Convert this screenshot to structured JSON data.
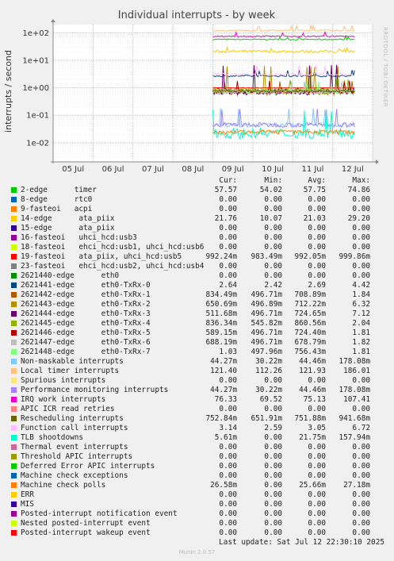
{
  "chart_data": {
    "type": "line",
    "title": "Individual interrupts - by week",
    "ylabel": "interrupts / second",
    "yscale": "log",
    "ylim": [
      0.002,
      200
    ],
    "y_ticks": [
      {
        "value": 100,
        "label": "1e+02"
      },
      {
        "value": 10,
        "label": "1e+01"
      },
      {
        "value": 1,
        "label": "1e+00"
      },
      {
        "value": 0.1,
        "label": "1e-01"
      },
      {
        "value": 0.01,
        "label": "1e-02"
      }
    ],
    "x_ticks": [
      "05 Jul",
      "06 Jul",
      "07 Jul",
      "08 Jul",
      "09 Jul",
      "10 Jul",
      "11 Jul",
      "12 Jul"
    ],
    "data_start_day": 4.0,
    "data_end_day": 7.55,
    "grid": true,
    "side_label": "RRDTOOL / TOBI OETIKER",
    "column_headers": [
      "Cur:",
      "Min:",
      "Avg:",
      "Max:"
    ],
    "series": [
      {
        "name": "2-edge      timer",
        "color": "#00cc00",
        "avg": 57.75,
        "min": 54.02,
        "max": 74.86,
        "cur": "57.57",
        "smin": "54.02",
        "savg": "57.75",
        "smax": "74.86"
      },
      {
        "name": "8-edge      rtc0",
        "color": "#0066b3",
        "avg": 0,
        "min": 0,
        "max": 0,
        "cur": "0.00",
        "smin": "0.00",
        "savg": "0.00",
        "smax": "0.00"
      },
      {
        "name": "9-fasteoi   acpi",
        "color": "#ff8000",
        "avg": 0,
        "min": 0,
        "max": 0,
        "cur": "0.00",
        "smin": "0.00",
        "savg": "0.00",
        "smax": "0.00"
      },
      {
        "name": "14-edge      ata_piix",
        "color": "#ffcc00",
        "avg": 21.03,
        "min": 10.07,
        "max": 29.2,
        "cur": "21.76",
        "smin": "10.07",
        "savg": "21.03",
        "smax": "29.20"
      },
      {
        "name": "15-edge      ata_piix",
        "color": "#330099",
        "avg": 0,
        "min": 0,
        "max": 0,
        "cur": "0.00",
        "smin": "0.00",
        "savg": "0.00",
        "smax": "0.00"
      },
      {
        "name": "16-fasteoi   uhci_hcd:usb3",
        "color": "#990099",
        "avg": 0,
        "min": 0,
        "max": 0,
        "cur": "0.00",
        "smin": "0.00",
        "savg": "0.00",
        "smax": "0.00"
      },
      {
        "name": "18-fasteoi   ehci_hcd:usb1, uhci_hcd:usb6",
        "color": "#ccff00",
        "avg": 0,
        "min": 0,
        "max": 0,
        "cur": "0.00",
        "smin": "0.00",
        "savg": "0.00",
        "smax": "0.00"
      },
      {
        "name": "19-fasteoi   ata_piix, uhci_hcd:usb5",
        "color": "#ff0000",
        "avg": 0.99205,
        "min": 0.98349,
        "max": 0.99986,
        "cur": "992.24m",
        "smin": "983.49m",
        "savg": "992.05m",
        "smax": "999.86m"
      },
      {
        "name": "23-fasteoi   ehci_hcd:usb2, uhci_hcd:usb4",
        "color": "#808080",
        "avg": 0,
        "min": 0,
        "max": 0,
        "cur": "0.00",
        "smin": "0.00",
        "savg": "0.00",
        "smax": "0.00"
      },
      {
        "name": "2621440-edge      eth0",
        "color": "#008f00",
        "avg": 0,
        "min": 0,
        "max": 0,
        "cur": "0.00",
        "smin": "0.00",
        "savg": "0.00",
        "smax": "0.00"
      },
      {
        "name": "2621441-edge      eth0-TxRx-0",
        "color": "#00487d",
        "avg": 2.69,
        "min": 2.42,
        "max": 4.42,
        "cur": "2.64",
        "smin": "2.42",
        "savg": "2.69",
        "smax": "4.42"
      },
      {
        "name": "2621442-edge      eth0-TxRx-1",
        "color": "#b35a00",
        "avg": 0.70889,
        "min": 0.49671,
        "max": 1.84,
        "cur": "834.49m",
        "smin": "496.71m",
        "savg": "708.89m",
        "smax": "1.84"
      },
      {
        "name": "2621443-edge      eth0-TxRx-2",
        "color": "#b38f00",
        "avg": 0.71222,
        "min": 0.49689,
        "max": 6.32,
        "cur": "650.69m",
        "smin": "496.89m",
        "savg": "712.22m",
        "smax": "6.32"
      },
      {
        "name": "2621444-edge      eth0-TxRx-3",
        "color": "#6b006b",
        "avg": 0.72465,
        "min": 0.49671,
        "max": 7.12,
        "cur": "511.68m",
        "smin": "496.71m",
        "savg": "724.65m",
        "smax": "7.12"
      },
      {
        "name": "2621445-edge      eth0-TxRx-4",
        "color": "#8fb300",
        "avg": 0.86056,
        "min": 0.54582,
        "max": 2.04,
        "cur": "836.34m",
        "smin": "545.82m",
        "savg": "860.56m",
        "smax": "2.04"
      },
      {
        "name": "2621446-edge      eth0-TxRx-5",
        "color": "#b30000",
        "avg": 0.7244,
        "min": 0.49671,
        "max": 1.81,
        "cur": "589.15m",
        "smin": "496.71m",
        "savg": "724.40m",
        "smax": "1.81"
      },
      {
        "name": "2621447-edge      eth0-TxRx-6",
        "color": "#bebebe",
        "avg": 0.67879,
        "min": 0.49671,
        "max": 1.82,
        "cur": "688.19m",
        "smin": "496.71m",
        "savg": "678.79m",
        "smax": "1.82"
      },
      {
        "name": "2621448-edge      eth0-TxRx-7",
        "color": "#80ff80",
        "avg": 0.75643,
        "min": 0.49796,
        "max": 1.81,
        "cur": "1.03",
        "smin": "497.96m",
        "savg": "756.43m",
        "smax": "1.81"
      },
      {
        "name": "Non-maskable interrupts",
        "color": "#80c9ff",
        "avg": 0.04446,
        "min": 0.03022,
        "max": 0.17808,
        "cur": "44.27m",
        "smin": "30.22m",
        "savg": "44.46m",
        "smax": "178.08m"
      },
      {
        "name": "Local timer interrupts",
        "color": "#ffc080",
        "avg": 121.93,
        "min": 112.26,
        "max": 186.01,
        "cur": "121.40",
        "smin": "112.26",
        "savg": "121.93",
        "smax": "186.01"
      },
      {
        "name": "Spurious interrupts",
        "color": "#ffe680",
        "avg": 0,
        "min": 0,
        "max": 0,
        "cur": "0.00",
        "smin": "0.00",
        "savg": "0.00",
        "smax": "0.00"
      },
      {
        "name": "Performance monitoring interrupts",
        "color": "#aa80ff",
        "avg": 0.04446,
        "min": 0.03022,
        "max": 0.17808,
        "cur": "44.27m",
        "smin": "30.22m",
        "savg": "44.46m",
        "smax": "178.08m"
      },
      {
        "name": "IRQ work interrupts",
        "color": "#ee00cc",
        "avg": 75.13,
        "min": 69.52,
        "max": 107.41,
        "cur": "76.33",
        "smin": "69.52",
        "savg": "75.13",
        "smax": "107.41"
      },
      {
        "name": "APIC ICR read retries",
        "color": "#ff8080",
        "avg": 0,
        "min": 0,
        "max": 0,
        "cur": "0.00",
        "smin": "0.00",
        "savg": "0.00",
        "smax": "0.00"
      },
      {
        "name": "Rescheduling interrupts",
        "color": "#666600",
        "avg": 0.75189,
        "min": 0.65191,
        "max": 0.94168,
        "cur": "752.84m",
        "smin": "651.91m",
        "savg": "751.88m",
        "smax": "941.68m"
      },
      {
        "name": "Function call interrupts",
        "color": "#ffbfff",
        "avg": 3.05,
        "min": 2.59,
        "max": 6.72,
        "cur": "3.14",
        "smin": "2.59",
        "savg": "3.05",
        "smax": "6.72"
      },
      {
        "name": "TLB shootdowns",
        "color": "#00ffcc",
        "avg": 0.02175,
        "min": 0,
        "max": 0.15794,
        "cur": "5.61m",
        "smin": "0.00",
        "savg": "21.75m",
        "smax": "157.94m"
      },
      {
        "name": "Thermal event interrupts",
        "color": "#cc6699",
        "avg": 0,
        "min": 0,
        "max": 0,
        "cur": "0.00",
        "smin": "0.00",
        "savg": "0.00",
        "smax": "0.00"
      },
      {
        "name": "Threshold APIC interrupts",
        "color": "#999900",
        "avg": 0,
        "min": 0,
        "max": 0,
        "cur": "0.00",
        "smin": "0.00",
        "savg": "0.00",
        "smax": "0.00"
      },
      {
        "name": "Deferred Error APIC interrupts",
        "color": "#00cc00",
        "avg": 0,
        "min": 0,
        "max": 0,
        "cur": "0.00",
        "smin": "0.00",
        "savg": "0.00",
        "smax": "0.00"
      },
      {
        "name": "Machine check exceptions",
        "color": "#0066b3",
        "avg": 0,
        "min": 0,
        "max": 0,
        "cur": "0.00",
        "smin": "0.00",
        "savg": "0.00",
        "smax": "0.00"
      },
      {
        "name": "Machine check polls",
        "color": "#ff8000",
        "avg": 0.02566,
        "min": 0,
        "max": 0.02718,
        "cur": "26.58m",
        "smin": "0.00",
        "savg": "25.66m",
        "smax": "27.18m"
      },
      {
        "name": "ERR",
        "color": "#ffcc00",
        "avg": 0,
        "min": 0,
        "max": 0,
        "cur": "0.00",
        "smin": "0.00",
        "savg": "0.00",
        "smax": "0.00"
      },
      {
        "name": "MIS",
        "color": "#330099",
        "avg": 0,
        "min": 0,
        "max": 0,
        "cur": "0.00",
        "smin": "0.00",
        "savg": "0.00",
        "smax": "0.00"
      },
      {
        "name": "Posted-interrupt notification event",
        "color": "#990099",
        "avg": 0,
        "min": 0,
        "max": 0,
        "cur": "0.00",
        "smin": "0.00",
        "savg": "0.00",
        "smax": "0.00"
      },
      {
        "name": "Nested posted-interrupt event",
        "color": "#ccff00",
        "avg": 0,
        "min": 0,
        "max": 0,
        "cur": "0.00",
        "smin": "0.00",
        "savg": "0.00",
        "smax": "0.00"
      },
      {
        "name": "Posted-interrupt wakeup event",
        "color": "#ff0000",
        "avg": 0,
        "min": 0,
        "max": 0,
        "cur": "0.00",
        "smin": "0.00",
        "savg": "0.00",
        "smax": "0.00"
      }
    ]
  },
  "footer": {
    "last_update": "Last update: Sat Jul 12 22:30:10 2025",
    "munin_version": "Munin 2.0.57"
  }
}
